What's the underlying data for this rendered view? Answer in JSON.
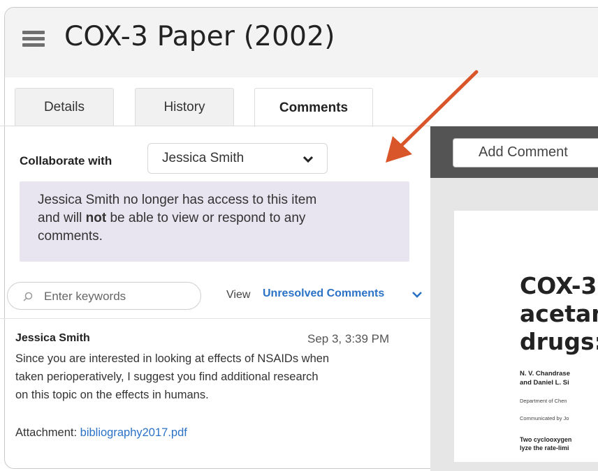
{
  "header": {
    "title": "COX-3 Paper (2002)"
  },
  "tabs": [
    {
      "label": "Details"
    },
    {
      "label": "History"
    },
    {
      "label": "Comments"
    }
  ],
  "collaborate": {
    "label": "Collaborate with",
    "selected": "Jessica Smith"
  },
  "notice": {
    "line1": "Jessica Smith no longer has access to this item",
    "line2_pre": "and will ",
    "line2_bold": "not",
    "line2_post": " be able to view or respond to any",
    "line3": "comments."
  },
  "search": {
    "placeholder": "Enter keywords"
  },
  "view": {
    "label": "View",
    "selected": "Unresolved Comments"
  },
  "comment": {
    "author": "Jessica Smith",
    "time": "Sep 3, 3:39 PM",
    "lines": [
      "Since you are interested in looking at effects of NSAIDs when",
      "taken perioperatively, I suggest you find additional research",
      "on this topic on the effects in humans."
    ],
    "attachment_label": "Attachment: ",
    "attachment_file": "bibliography2017.pdf"
  },
  "viewer": {
    "add_comment": "Add Comment",
    "paper_title": "COX-3,\nacetam\ndrugs: ",
    "paper_authors": "N. V. Chandrase\nand Daniel L. Si",
    "paper_dept": "Department of Chen",
    "paper_comm": "Communicated by Jo",
    "paper_abstract": "Two cyclooxygen\nlyze the rate-limi"
  },
  "colors": {
    "accent": "#2a72c6",
    "notice_bg": "#e8e5f0",
    "arrow": "#d9562a",
    "viewer_bar": "#545454"
  }
}
